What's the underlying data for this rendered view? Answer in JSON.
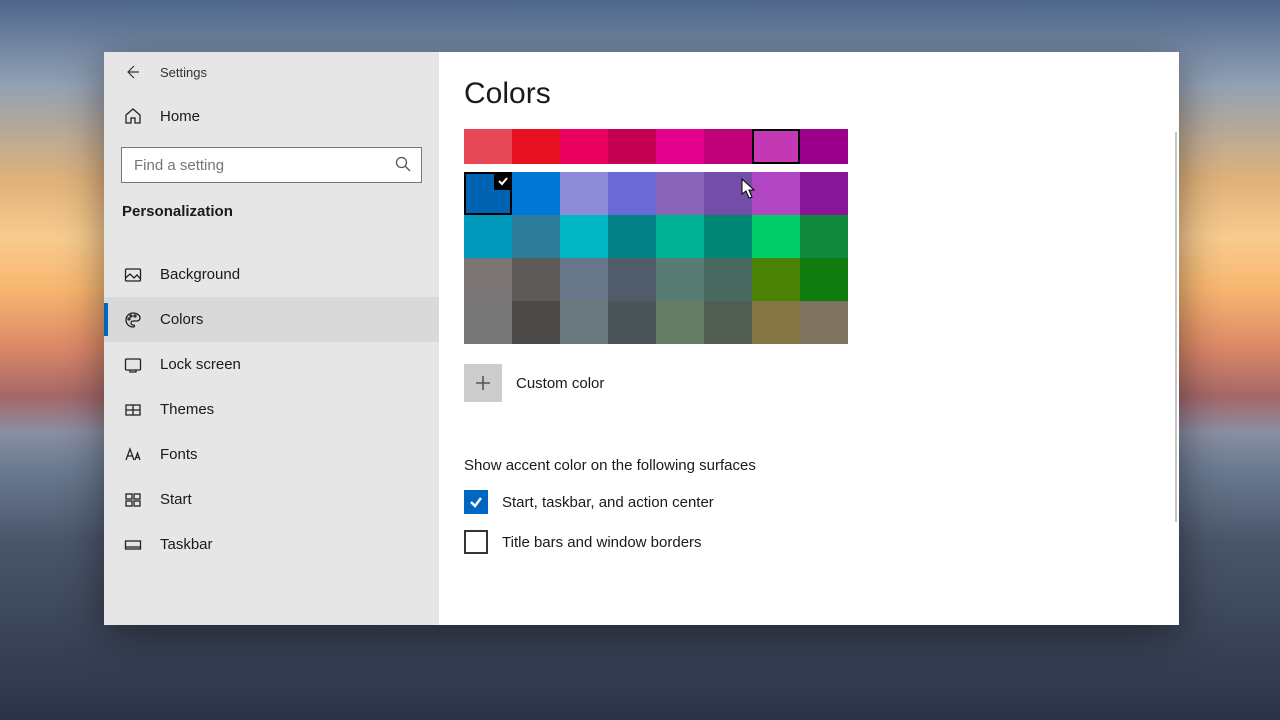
{
  "window": {
    "title": "Settings"
  },
  "sidebar": {
    "home": "Home",
    "search_placeholder": "Find a setting",
    "category": "Personalization",
    "items": [
      {
        "label": "Background"
      },
      {
        "label": "Colors"
      },
      {
        "label": "Lock screen"
      },
      {
        "label": "Themes"
      },
      {
        "label": "Fonts"
      },
      {
        "label": "Start"
      },
      {
        "label": "Taskbar"
      }
    ]
  },
  "page": {
    "title": "Colors",
    "custom_color": "Custom color",
    "surfaces_label": "Show accent color on the following surfaces",
    "cb_start": "Start, taskbar, and action center",
    "cb_title": "Title bars and window borders"
  },
  "palette": [
    [
      "#e74856",
      "#e81123",
      "#ea005e",
      "#c30052",
      "#e3008c",
      "#bf0077",
      "#c239b3",
      "#9a0089"
    ],
    [
      "#0063b1",
      "#0078d7",
      "#8e8cd8",
      "#6b69d6",
      "#8764b8",
      "#744da9",
      "#b146c2",
      "#881798"
    ],
    [
      "#0099bc",
      "#2d7d9a",
      "#00b7c3",
      "#038387",
      "#00b294",
      "#018574",
      "#00cc6a",
      "#10893e"
    ],
    [
      "#7a7574",
      "#5d5a58",
      "#68768a",
      "#515c6b",
      "#567c73",
      "#486860",
      "#498205",
      "#107c10"
    ],
    [
      "#767676",
      "#4c4a48",
      "#69797e",
      "#4a5459",
      "#647c64",
      "#525e54",
      "#847545",
      "#7e735f"
    ]
  ],
  "selected": {
    "row": 1,
    "col": 0
  },
  "hovered": {
    "row": 0,
    "col": 6
  },
  "accent": "#0067c0"
}
